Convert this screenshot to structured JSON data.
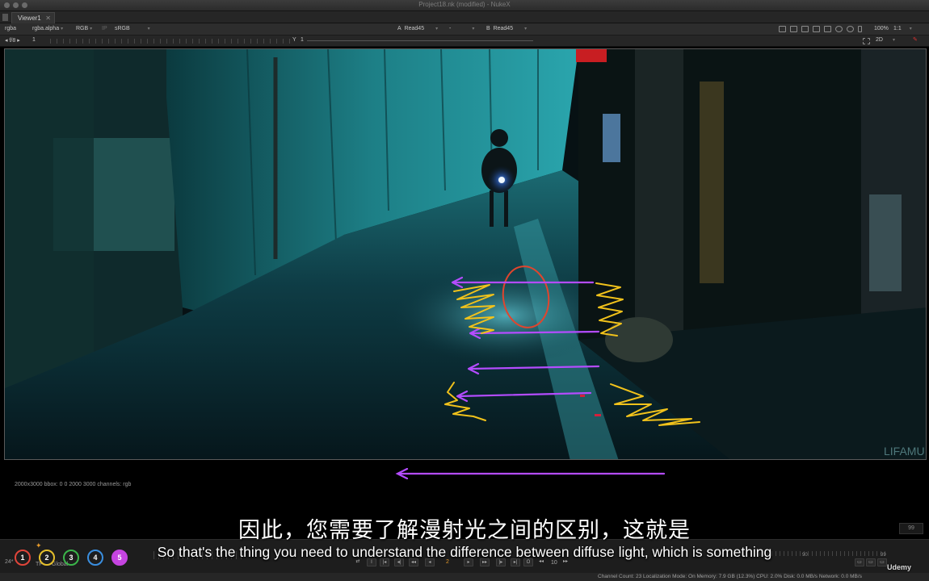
{
  "window": {
    "title": "Project18.nk (modified) - NukeX"
  },
  "tabs": [
    {
      "label": "Viewer1"
    }
  ],
  "viewer_bar": {
    "channels": "rgba",
    "alpha": "rgba.alpha",
    "display": "RGB",
    "ip": "IP",
    "lut": "sRGB",
    "input_a_label": "A",
    "input_a": "Read45",
    "mode": "-",
    "input_b_label": "B",
    "input_b": "Read45",
    "zoom": "100%",
    "ratio": "1:1"
  },
  "viewer_bar2": {
    "fstop": "f/8",
    "gain": "1",
    "y_label": "Y",
    "gamma": "1",
    "view_mode": "2D"
  },
  "image": {
    "watermark": "LIFAMU",
    "format_info": "2000x3000  bbox: 0 0 2000 3000  channels: rgb"
  },
  "subtitles": {
    "chinese": "因此，您需要了解漫射光之间的区别，这就是",
    "english": "So that's the thing you need to understand the difference between diffuse light, which is something"
  },
  "timeline": {
    "fps": "24*",
    "tf_label": "TF",
    "global_label": "Global",
    "markers": [
      "1",
      "2",
      "3",
      "4",
      "5"
    ],
    "marker_colors": [
      "#e0453a",
      "#e6c02c",
      "#3bb54a",
      "#3a8fe0",
      "#c544e0"
    ],
    "current_frame": "2",
    "step": "10",
    "tick_90": "90",
    "tick_99": "99",
    "end_frame": "99"
  },
  "status": {
    "text": "Channel Count: 23  Localization Mode: On  Memory: 7.9 GB (12.3%)  CPU: 2.0%  Disk: 0.0 MB/s  Network: 0.0 MB/s"
  },
  "watermark_brand": "Udemy"
}
